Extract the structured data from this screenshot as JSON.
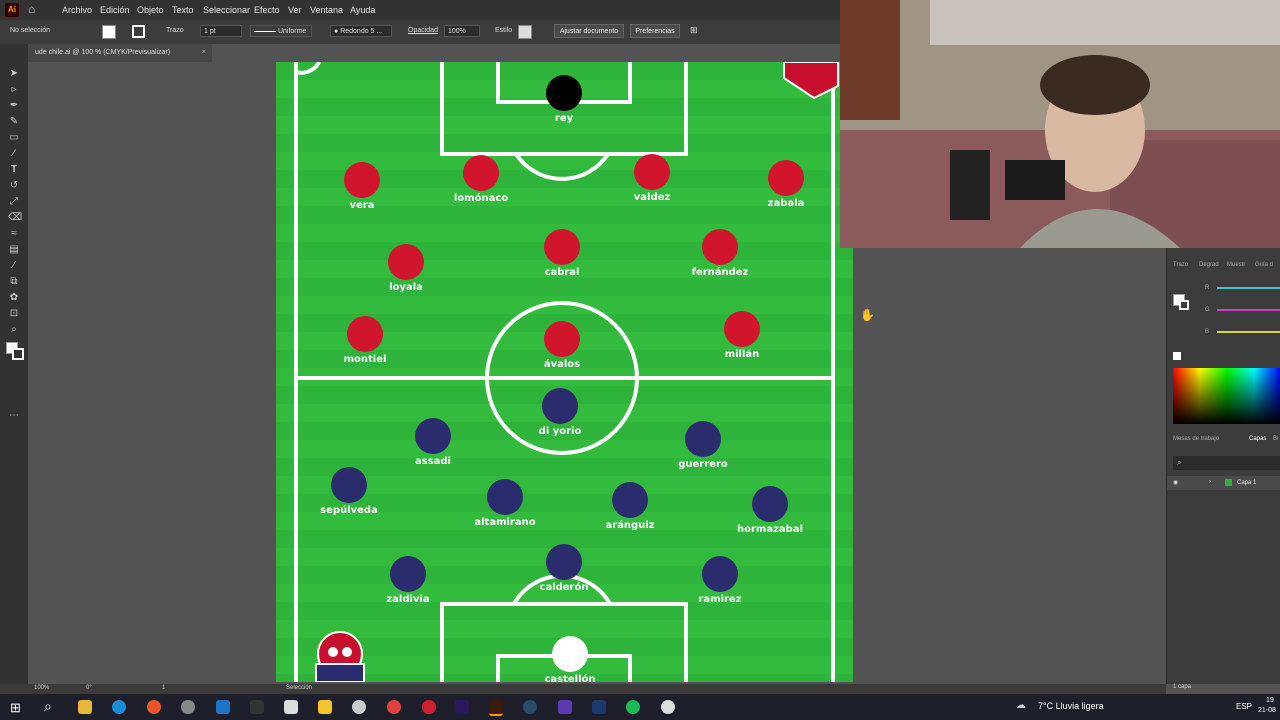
{
  "menubar": {
    "items": [
      "Archivo",
      "Edición",
      "Objeto",
      "Texto",
      "Seleccionar",
      "Efecto",
      "Ver",
      "Ventana",
      "Ayuda"
    ]
  },
  "controlbar": {
    "selection_status": "No selección",
    "stroke_label": "Trazo",
    "stroke_weight": "1 pt",
    "stroke_profile": "Uniforme",
    "brush": "Redondo 5 ...",
    "opacity_label": "Opacidad",
    "opacity_value": "100%",
    "style_label": "Estilo",
    "fit_button": "Ajustar documento",
    "prefs_button": "Preferencias"
  },
  "document_tab": {
    "title": "ude chile.ai @ 100 % (CMYK/Previsualizar)",
    "close": "×"
  },
  "field": {
    "grass_color": "#2eb43a",
    "red_team_color": "#d0152d",
    "blue_team_color": "#2a2c6e",
    "players": [
      {
        "name": "rey",
        "team": "black"
      },
      {
        "name": "vera",
        "team": "red"
      },
      {
        "name": "lomónaco",
        "team": "red"
      },
      {
        "name": "valdez",
        "team": "red"
      },
      {
        "name": "zabala",
        "team": "red"
      },
      {
        "name": "loyala",
        "team": "red"
      },
      {
        "name": "cabral",
        "team": "red"
      },
      {
        "name": "fernández",
        "team": "red"
      },
      {
        "name": "montiel",
        "team": "red"
      },
      {
        "name": "ávalos",
        "team": "red"
      },
      {
        "name": "millán",
        "team": "red"
      },
      {
        "name": "di yorio",
        "team": "blue"
      },
      {
        "name": "assadi",
        "team": "blue"
      },
      {
        "name": "guerrero",
        "team": "blue"
      },
      {
        "name": "sepúlveda",
        "team": "blue"
      },
      {
        "name": "altamirano",
        "team": "blue"
      },
      {
        "name": "aránguiz",
        "team": "blue"
      },
      {
        "name": "hormazabal",
        "team": "blue"
      },
      {
        "name": "calderón",
        "team": "blue"
      },
      {
        "name": "zaldivia",
        "team": "blue"
      },
      {
        "name": "ramirez",
        "team": "blue"
      },
      {
        "name": "castellón",
        "team": "white"
      }
    ]
  },
  "right_panel": {
    "tabs": [
      "Trazo",
      "Degrad",
      "Muestr",
      "Guía d"
    ],
    "channels": [
      "R",
      "G",
      "B"
    ],
    "layer_tabs": [
      "Mesas de trabajo",
      "Capas",
      "Bi"
    ],
    "layer_name": "Capa 1",
    "layers_count": "1 capa"
  },
  "statusbar": {
    "zoom": "100%",
    "rotation": "0°",
    "artboard": "1",
    "tool": "Selección"
  },
  "taskbar": {
    "weather": "7°C  Lluvia ligera",
    "lang": "ESP",
    "time": "19",
    "date": "21-08"
  }
}
